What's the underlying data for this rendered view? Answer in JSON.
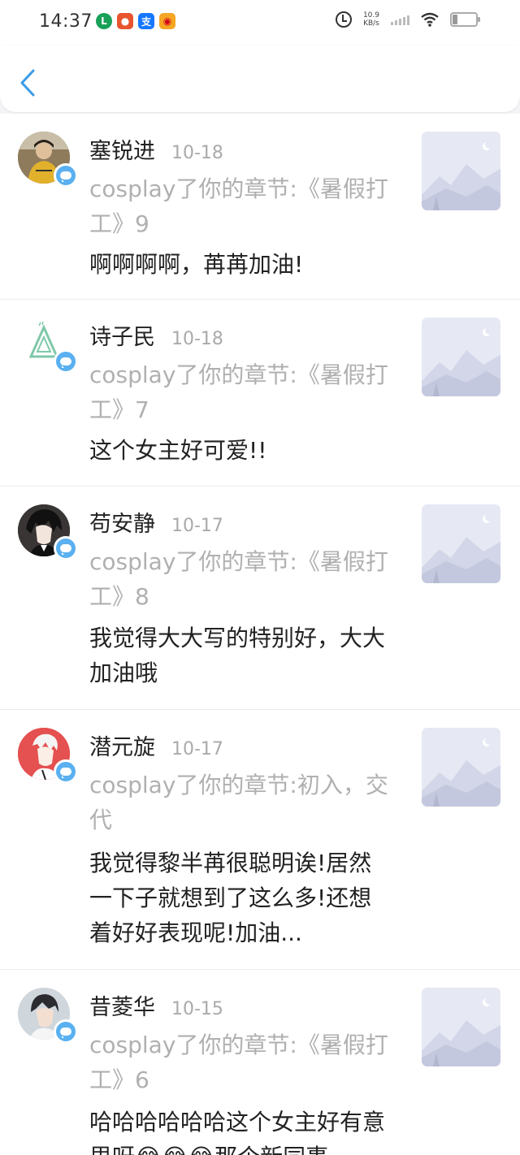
{
  "status_bar": {
    "time": "14:37",
    "net_speed_value": "10.9",
    "net_speed_unit": "KB/s",
    "icons": [
      "notification-app-icon",
      "notification-game-icon",
      "alipay-icon",
      "weibo-icon",
      "alarm-icon",
      "signal-icon",
      "wifi-icon",
      "battery-icon"
    ]
  },
  "nav": {
    "back_icon": "chevron-left-icon",
    "accent_color": "#3a9be8"
  },
  "badge_color": "#5ab0f0",
  "items": [
    {
      "name": "塞锐进",
      "date": "10-18",
      "chapter": "cosplay了你的章节:《暑假打工》9",
      "comment": "啊啊啊啊，苒苒加油!"
    },
    {
      "name": "诗子民",
      "date": "10-18",
      "chapter": "cosplay了你的章节:《暑假打工》7",
      "comment": "这个女主好可爱!!"
    },
    {
      "name": "苟安静",
      "date": "10-17",
      "chapter": "cosplay了你的章节:《暑假打工》8",
      "comment": "我觉得大大写的特别好，大大加油哦"
    },
    {
      "name": "潜元旋",
      "date": "10-17",
      "chapter": "cosplay了你的章节:初入，交代",
      "comment": "我觉得黎半苒很聪明诶!居然一下子就想到了这么多!还想着好好表现呢!加油..."
    },
    {
      "name": "昔菱华",
      "date": "10-15",
      "chapter": "cosplay了你的章节:《暑假打工》6",
      "comment": "哈哈哈哈哈哈这个女主好有意思呀😂😂😂那个新同事"
    }
  ]
}
